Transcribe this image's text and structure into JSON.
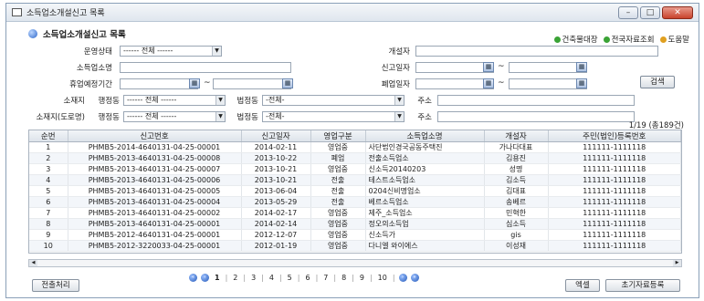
{
  "window": {
    "title": "소득업소개설신고 목록"
  },
  "heading": "소득업소개설신고 목록",
  "top_links": [
    {
      "label": "건축물대장",
      "color": "#3aa335"
    },
    {
      "label": "전국자료조회",
      "color": "#3aa335"
    },
    {
      "label": "도움말",
      "color": "#e0a020"
    }
  ],
  "form": {
    "status_label": "운영상태",
    "status_value": "------ 전체 ------",
    "opener_label": "개설자",
    "business_label": "소득업소명",
    "report_date_label": "신고일자",
    "suspend_label": "휴업예정기간",
    "closure_label": "폐업일자",
    "addr_label": "소재지",
    "addr_road_label": "소재지(도로명)",
    "district_label": "행정동",
    "district_value": "------ 전체 ------",
    "legal_label": "법정동",
    "legal_value": "-전체-",
    "detail_label": "주소",
    "road_label": "행정동",
    "road_value": "------ 전체 ------",
    "road_legal_label": "법정동",
    "road_legal_value": "-전체-",
    "road_detail_label": "주소",
    "tilde": "~",
    "search_button": "검색"
  },
  "count_text": "1/19 (총189건)",
  "table": {
    "columns": [
      "순번",
      "신고번호",
      "신고일자",
      "영업구분",
      "소득업소명",
      "개설자",
      "주민(법인)등록번호"
    ],
    "rows": [
      [
        "1",
        "PHMB5-2014-4640131-04-25-00001",
        "2014-02-11",
        "영업중",
        "사단법인경국공동주택진",
        "가나다대표",
        "111111-1111118"
      ],
      [
        "2",
        "PHMB5-2013-4640131-04-25-00008",
        "2013-10-22",
        "폐업",
        "전출소득업소",
        "김용진",
        "111111-1111118"
      ],
      [
        "3",
        "PHMB5-2013-4640131-04-25-00007",
        "2013-10-21",
        "영업중",
        "신소득20140203",
        "성명",
        "111111-1111118"
      ],
      [
        "4",
        "PHMB5-2013-4640131-04-25-00006",
        "2013-10-21",
        "전출",
        "테스트소득업소",
        "김소득",
        "111111-1111118"
      ],
      [
        "5",
        "PHMB5-2013-4640131-04-25-00005",
        "2013-06-04",
        "전출",
        "0204신비명업소",
        "김대표",
        "111111-1111118"
      ],
      [
        "6",
        "PHMB5-2013-4640131-04-25-00004",
        "2013-05-29",
        "전출",
        "베르소득업소",
        "송베르",
        "111111-1111118"
      ],
      [
        "7",
        "PHMB5-2013-4640131-04-25-00002",
        "2014-02-17",
        "영업중",
        "제주_소득업소",
        "민혁한",
        "111111-1111118"
      ],
      [
        "8",
        "PHMB5-2013-4640131-04-25-00001",
        "2014-02-14",
        "영업중",
        "정오의소득업",
        "심소득",
        "111111-1111118"
      ],
      [
        "9",
        "PHMB5-2012-4640131-04-25-00001",
        "2012-12-07",
        "영업중",
        "신소득가",
        "gis",
        "111111-1111118"
      ],
      [
        "10",
        "PHMB5-2012-3220033-04-25-00001",
        "2012-01-19",
        "영업중",
        "다니엘 와이에스",
        "이성재",
        "111111-1111118"
      ]
    ]
  },
  "pager": {
    "pages": [
      "1",
      "2",
      "3",
      "4",
      "5",
      "6",
      "7",
      "8",
      "9",
      "10"
    ],
    "current": "1"
  },
  "buttons": {
    "transfer": "전출처리",
    "excel": "엑셀",
    "initial": "초기자료등록"
  }
}
